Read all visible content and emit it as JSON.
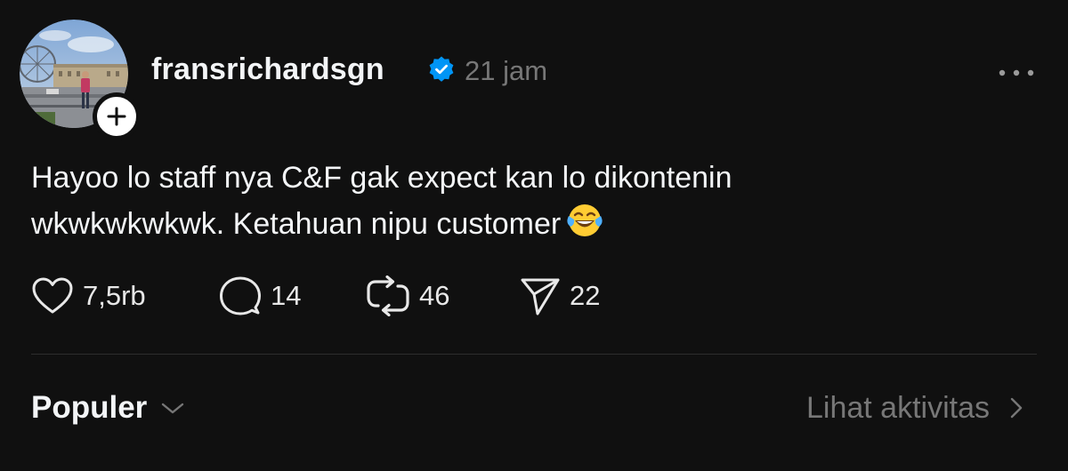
{
  "post": {
    "username": "fransrichardsgn",
    "verified_icon": "verified-badge-icon",
    "timestamp": "21 jam",
    "more_icon": "more-options-icon",
    "text_line1": "Hayoo lo staff nya C&F gak expect kan lo dikontenin",
    "text_line2": "wkwkwkwkwk. Ketahuan nipu customer",
    "emoji_icon": "face-with-tears-of-joy-icon"
  },
  "actions": {
    "likes": "7,5rb",
    "replies": "14",
    "reposts": "46",
    "shares": "22"
  },
  "footer": {
    "sort_label": "Populer",
    "activity_label": "Lihat aktivitas"
  },
  "colors": {
    "background": "#101010",
    "text_primary": "#f3f5f7",
    "text_secondary": "#777777",
    "verified_blue": "#0095f6",
    "divider": "#2d2d2d"
  }
}
